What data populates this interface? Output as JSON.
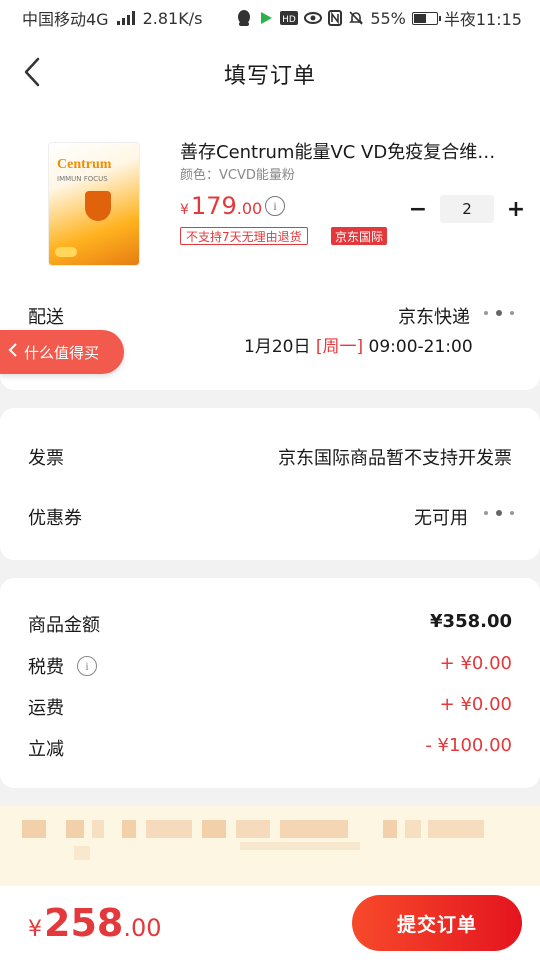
{
  "status_bar": {
    "carrier": "中国移动4G",
    "network_speed": "2.81K/s",
    "battery_percent": "55%",
    "battery_level": 0.55,
    "time": "半夜11:15",
    "icons": [
      "signal-icon",
      "qq-icon",
      "video-icon",
      "hd-icon",
      "eye-icon",
      "nfc-icon",
      "mute-icon",
      "battery-icon"
    ]
  },
  "header": {
    "title": "填写订单",
    "back_icon": "chevron-left-icon"
  },
  "product": {
    "title": "善存Centrum能量VC VD免疫复合维…",
    "spec": "颜色：VCVD能量粉",
    "price_currency": "¥",
    "price_int": "179",
    "price_dec": ".00",
    "quantity": "2",
    "minus_label": "−",
    "plus_label": "+",
    "tag_no_return": "不支持7天无理由退货",
    "tag_intl": "京东国际",
    "image_brand": "Centrum",
    "image_sub": "IMMUN FOCUS"
  },
  "delivery": {
    "label": "配送",
    "carrier": "京东快递",
    "date": "1月20日",
    "weekday": "[周一]",
    "time_range": "09:00-21:00"
  },
  "floating_tab": {
    "label": "什么值得买"
  },
  "invoice": {
    "label": "发票",
    "value": "京东国际商品暂不支持开发票"
  },
  "coupon": {
    "label": "优惠券",
    "value": "无可用"
  },
  "summary": {
    "goods_label": "商品金额",
    "goods_value": "¥358.00",
    "tax_label": "税费",
    "tax_value": "+ ¥0.00",
    "shipping_label": "运费",
    "shipping_value": "+ ¥0.00",
    "discount_label": "立减",
    "discount_value": "- ¥100.00"
  },
  "bottom": {
    "total_currency": "¥",
    "total_int": "258",
    "total_dec": ".00",
    "submit_label": "提交订单"
  },
  "colors": {
    "accent": "#e4393c",
    "notice_bg": "#fdf6e3",
    "page_bg": "#f2f2f2"
  }
}
